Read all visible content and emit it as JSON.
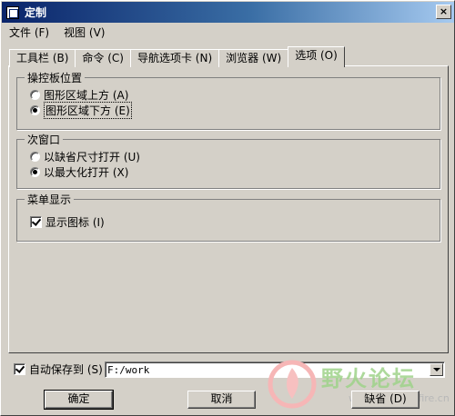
{
  "window": {
    "title": "定制",
    "close_label": "×"
  },
  "menu": {
    "items": [
      "文件 (F)",
      "视图 (V)"
    ]
  },
  "tabs": [
    {
      "label": "工具栏 (B)"
    },
    {
      "label": "命令 (C)"
    },
    {
      "label": "导航选项卡 (N)"
    },
    {
      "label": "浏览器 (W)"
    },
    {
      "label": "选项 (O)",
      "active": true
    }
  ],
  "groups": {
    "panel_position": {
      "label": "操控板位置",
      "options": [
        {
          "label": "图形区域上方 (A)",
          "checked": false
        },
        {
          "label": "图形区域下方 (E)",
          "checked": true
        }
      ]
    },
    "secondary_window": {
      "label": "次窗口",
      "options": [
        {
          "label": "以缺省尺寸打开 (U)",
          "checked": false
        },
        {
          "label": "以最大化打开 (X)",
          "checked": true
        }
      ]
    },
    "menu_display": {
      "label": "菜单显示",
      "show_icons": {
        "label": "显示图标 (I)",
        "checked": true
      }
    }
  },
  "autosave": {
    "label": "自动保存到 (S)",
    "checked": true,
    "path": "F:/work"
  },
  "buttons": {
    "ok": "确定",
    "cancel": "取消",
    "default": "缺省 (D)"
  },
  "watermark": {
    "text": "野火论坛",
    "url": "www.proewildfire.cn"
  }
}
